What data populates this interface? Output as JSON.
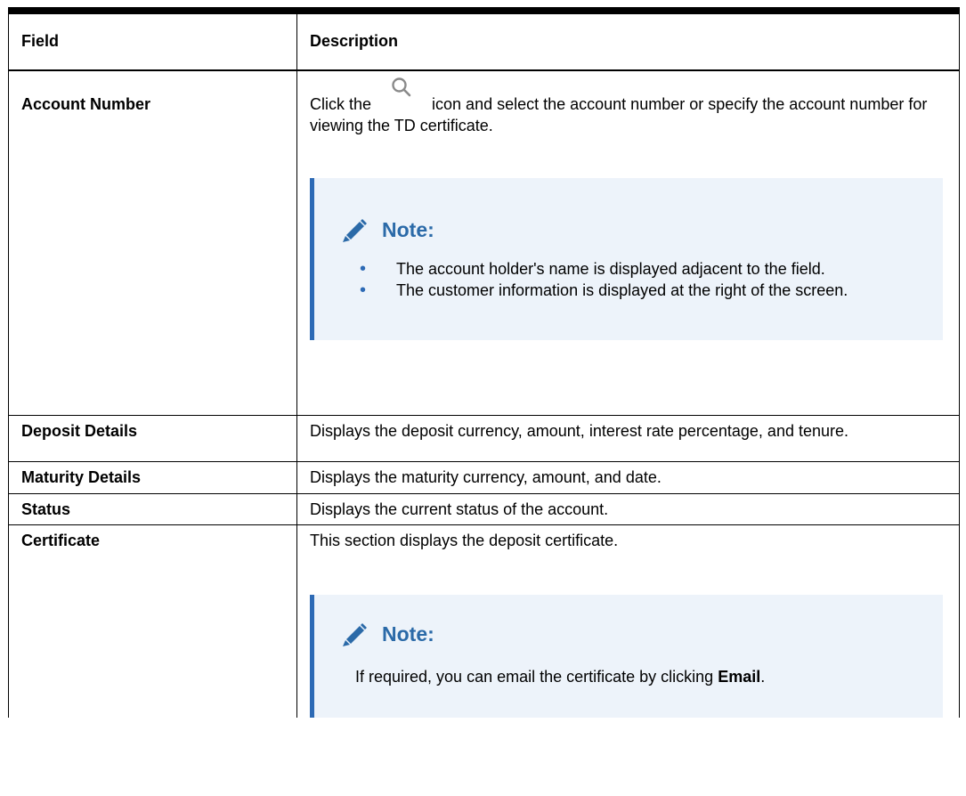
{
  "table": {
    "headers": [
      "Field",
      "Description"
    ],
    "rows": {
      "account": {
        "field": "Account Number",
        "desc_pre": "Click the",
        "desc_post": "icon and select the account number or specify the account number for viewing the TD certificate.",
        "icon": "search-icon",
        "note": {
          "title": "Note:",
          "items": [
            "The account holder's name is displayed adjacent to the field.",
            "The customer information is displayed at the right of the screen."
          ]
        }
      },
      "deposit": {
        "field": "Deposit Details",
        "desc": "Displays the deposit currency, amount, interest rate percentage, and tenure."
      },
      "maturity": {
        "field": "Maturity Details",
        "desc": "Displays the maturity currency, amount, and date."
      },
      "status": {
        "field": "Status",
        "desc": "Displays the current status of the account."
      },
      "certificate": {
        "field": "Certificate",
        "desc": "This section displays the deposit certificate.",
        "note": {
          "title": "Note:",
          "body_pre": "If required, you can email the certificate by clicking ",
          "body_bold": "Email",
          "body_post": "."
        }
      }
    }
  },
  "colors": {
    "note_background": "#edf3fa",
    "note_accent": "#2d6ab5",
    "note_title": "#2b6aa8"
  }
}
